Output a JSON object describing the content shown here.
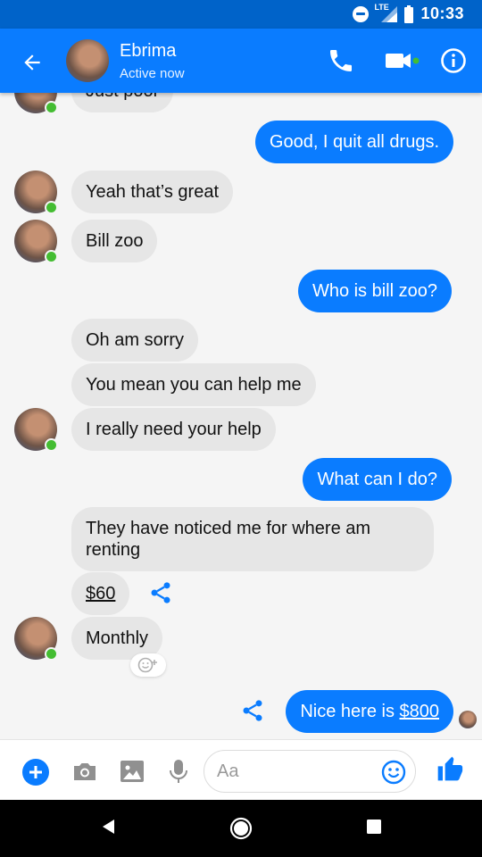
{
  "status_bar": {
    "network": "LTE",
    "time": "10:33"
  },
  "header": {
    "contact_name": "Ebrima",
    "contact_status": "Active now"
  },
  "messages": {
    "m0": "Just poor",
    "m1": "Good, I quit all drugs.",
    "m2": "Yeah that’s great",
    "m3": "Bill zoo",
    "m4": "Who is bill zoo?",
    "m5": "Oh am sorry",
    "m6": "You mean you can help me",
    "m7": "I really need your help",
    "m8": "What can I do?",
    "m9": "They have noticed me for where am renting",
    "m10": "$60",
    "m11": "Monthly",
    "m12_prefix": "Nice here is ",
    "m12_link": "$800"
  },
  "composer": {
    "placeholder": "Aa"
  },
  "colors": {
    "messenger_blue": "#0a7cff",
    "status_blue": "#0063c9",
    "online_green": "#44bd32",
    "incoming_bubble": "#e6e6e6"
  },
  "icons": [
    "back-arrow-icon",
    "phone-icon",
    "video-camera-icon",
    "info-icon",
    "share-icon",
    "add-reaction-icon",
    "plus-icon",
    "camera-icon",
    "image-icon",
    "microphone-icon",
    "emoji-icon",
    "thumbs-up-icon"
  ]
}
